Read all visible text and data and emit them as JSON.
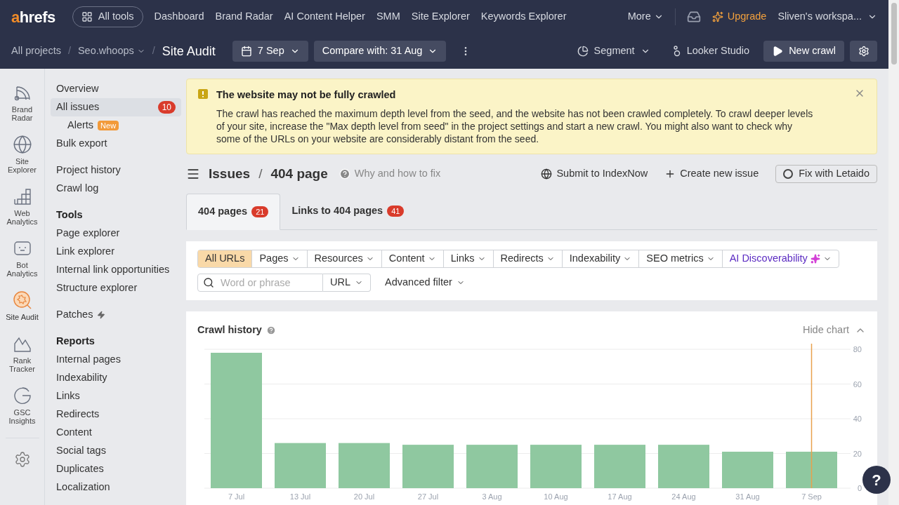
{
  "top_nav": {
    "logo": {
      "accent": "a",
      "rest": "hrefs"
    },
    "all_tools": "All tools",
    "links": [
      "Dashboard",
      "Brand Radar",
      "AI Content Helper",
      "SMM",
      "Site Explorer",
      "Keywords Explorer"
    ],
    "more": "More",
    "upgrade": "Upgrade",
    "workspace": "Sliven's workspa..."
  },
  "sub_bar": {
    "breadcrumbs": [
      "All projects",
      "Seo.whoops"
    ],
    "separator": "/",
    "current": "Site Audit",
    "date": "7 Sep",
    "compare": "Compare with: 31 Aug",
    "segment": "Segment",
    "looker": "Looker Studio",
    "new_crawl": "New crawl"
  },
  "rail": [
    {
      "kind": "radar",
      "label": "Brand Radar",
      "selected": false
    },
    {
      "kind": "globe",
      "label": "Site Explorer",
      "selected": false
    },
    {
      "kind": "analytics",
      "label": "Web Analytics",
      "selected": false
    },
    {
      "kind": "bot",
      "label": "Bot Analytics",
      "selected": false
    },
    {
      "kind": "audit",
      "label": "Site Audit",
      "selected": true
    },
    {
      "kind": "rank",
      "label": "Rank Tracker",
      "selected": false
    },
    {
      "kind": "gsc",
      "label": "GSC Insights",
      "selected": false
    }
  ],
  "sidebar": [
    {
      "items": [
        {
          "label": "Overview",
          "selected": false
        },
        {
          "label": "All issues",
          "selected": true,
          "badge": "10",
          "children": [
            {
              "label": "Alerts",
              "selected": false,
              "tag": "New"
            }
          ]
        },
        {
          "label": "Bulk export",
          "selected": false
        }
      ]
    },
    {
      "items": [
        {
          "label": "Project history",
          "selected": false
        },
        {
          "label": "Crawl log",
          "selected": false
        }
      ]
    },
    {
      "heading": "Tools",
      "items": [
        {
          "label": "Page explorer",
          "selected": false
        },
        {
          "label": "Link explorer",
          "selected": false
        },
        {
          "label": "Internal link opportunities",
          "selected": false
        },
        {
          "label": "Structure explorer",
          "selected": false
        }
      ]
    },
    {
      "items": [
        {
          "label": "Patches",
          "selected": false,
          "bolt": true
        }
      ]
    },
    {
      "heading": "Reports",
      "items": [
        {
          "label": "Internal pages",
          "selected": false
        },
        {
          "label": "Indexability",
          "selected": false
        },
        {
          "label": "Links",
          "selected": false
        },
        {
          "label": "Redirects",
          "selected": false
        },
        {
          "label": "Content",
          "selected": false
        },
        {
          "label": "Social tags",
          "selected": false
        },
        {
          "label": "Duplicates",
          "selected": false
        },
        {
          "label": "Localization",
          "selected": false
        }
      ]
    }
  ],
  "alert": {
    "title": "The website may not be fully crawled",
    "body": "The crawl has reached the maximum depth level from the seed, and the website has not been crawled completely. To crawl deeper levels of your site, increase the \"Max depth level from seed\" in the project settings and start a new crawl. You might also want to check why some of the URLs on your website are considerably distant from the seed."
  },
  "issue_header": {
    "parent": "Issues",
    "separator": "/",
    "current": "404 page",
    "help": "Why and how to fix",
    "actions": [
      "Submit to IndexNow",
      "Create new issue"
    ],
    "fix_button": "Fix with Letaido"
  },
  "tabs": [
    {
      "label": "404 pages",
      "count": "21",
      "selected": true
    },
    {
      "label": "Links to 404 pages",
      "count": "41",
      "selected": false
    }
  ],
  "filters": {
    "segments": [
      {
        "label": "All URLs",
        "selected": true,
        "kind": "plain"
      },
      {
        "label": "Pages",
        "selected": false,
        "kind": "dropdown"
      },
      {
        "label": "Resources",
        "selected": false,
        "kind": "dropdown"
      },
      {
        "label": "Content",
        "selected": false,
        "kind": "dropdown"
      },
      {
        "label": "Links",
        "selected": false,
        "kind": "dropdown"
      },
      {
        "label": "Redirects",
        "selected": false,
        "kind": "dropdown"
      },
      {
        "label": "Indexability",
        "selected": false,
        "kind": "dropdown"
      },
      {
        "label": "SEO metrics",
        "selected": false,
        "kind": "dropdown"
      },
      {
        "label": "AI Discoverability",
        "selected": false,
        "kind": "ai"
      }
    ],
    "search_placeholder": "Word or phrase",
    "url_select": "URL",
    "advanced": "Advanced filter"
  },
  "crawl_history": {
    "title": "Crawl history",
    "hide": "Hide chart",
    "chart_data": {
      "type": "bar",
      "categories": [
        "7 Jul",
        "13 Jul",
        "20 Jul",
        "27 Jul",
        "3 Aug",
        "10 Aug",
        "17 Aug",
        "24 Aug",
        "31 Aug",
        "7 Sep"
      ],
      "series": [
        {
          "color": "#8fc8a0",
          "values": [
            78,
            26,
            26,
            25,
            25,
            25,
            25,
            25,
            21,
            21
          ]
        }
      ],
      "ylim": [
        0,
        80
      ],
      "yticks": [
        0,
        20,
        40,
        60,
        80
      ],
      "grid": true,
      "ref_lines": [
        {
          "axis": "x",
          "value": "7 Sep",
          "color": "#e8a04c"
        }
      ]
    }
  },
  "help_button": "?"
}
